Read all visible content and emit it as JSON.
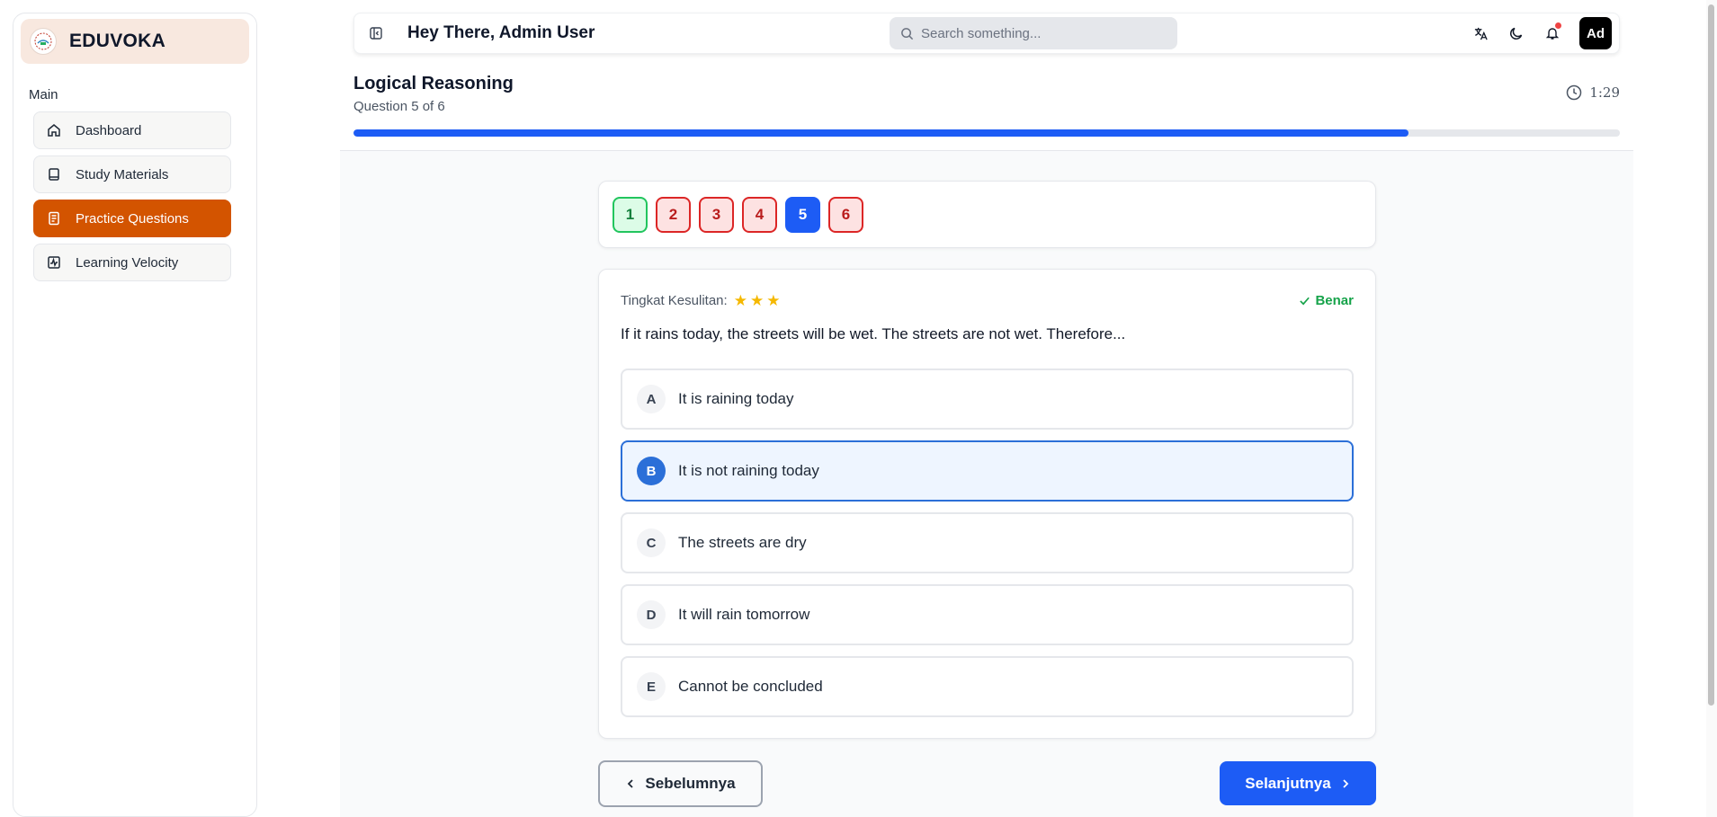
{
  "brand": {
    "name": "EDUVOKA"
  },
  "sidebar": {
    "section_label": "Main",
    "items": [
      {
        "label": "Dashboard",
        "icon": "home-icon"
      },
      {
        "label": "Study Materials",
        "icon": "book-icon"
      },
      {
        "label": "Practice Questions",
        "icon": "document-icon",
        "active": true
      },
      {
        "label": "Learning Velocity",
        "icon": "activity-icon"
      }
    ]
  },
  "header": {
    "greeting": "Hey There, Admin User",
    "search_placeholder": "Search something...",
    "avatar": "Ad"
  },
  "quiz": {
    "title": "Logical Reasoning",
    "subtitle": "Question 5 of 6",
    "timer": "1:29",
    "progress_percent": 83.3,
    "question_nav": [
      {
        "label": "1",
        "status": "correct"
      },
      {
        "label": "2",
        "status": "wrong"
      },
      {
        "label": "3",
        "status": "wrong"
      },
      {
        "label": "4",
        "status": "wrong"
      },
      {
        "label": "5",
        "status": "current"
      },
      {
        "label": "6",
        "status": "wrong"
      }
    ],
    "difficulty_label": "Tingkat Kesulitan:",
    "difficulty_stars": 3,
    "result_label": "Benar",
    "question_text": "If it rains today, the streets will be wet. The streets are not wet. Therefore...",
    "options": [
      {
        "letter": "A",
        "text": "It is raining today"
      },
      {
        "letter": "B",
        "text": "It is not raining today",
        "selected": true
      },
      {
        "letter": "C",
        "text": "The streets are dry"
      },
      {
        "letter": "D",
        "text": "It will rain tomorrow"
      },
      {
        "letter": "E",
        "text": "Cannot be concluded"
      }
    ],
    "prev_label": "Sebelumnya",
    "next_label": "Selanjutnya"
  },
  "colors": {
    "accent": "#d35400",
    "primary": "#1d5cf5",
    "success": "#16a34a",
    "danger": "#dc2626"
  }
}
